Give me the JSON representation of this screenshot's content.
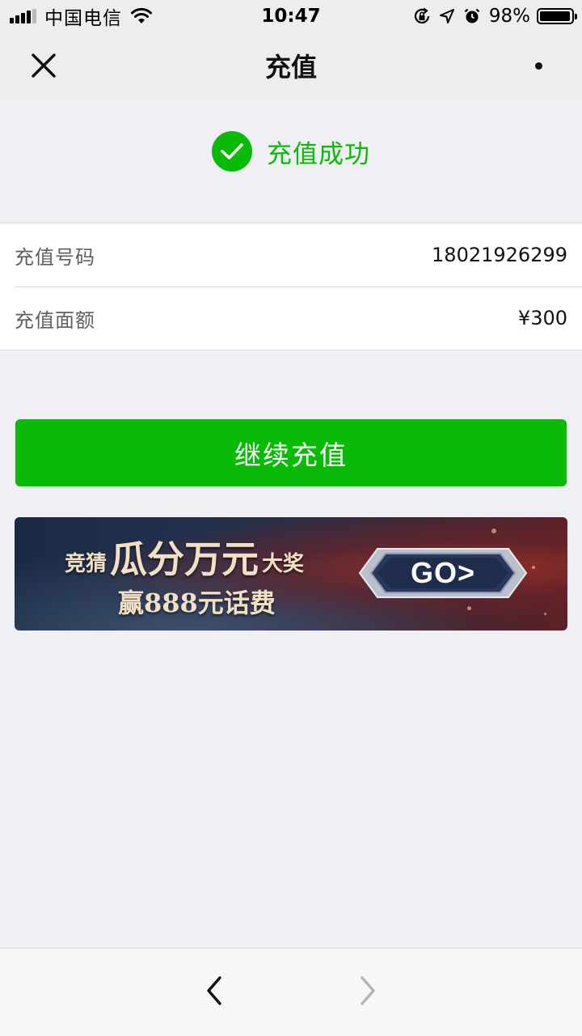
{
  "status_bar": {
    "carrier": "中国电信",
    "time": "10:47",
    "battery_percent": "98%",
    "battery_level": 0.98,
    "signal_bars": 4,
    "icons": [
      "wifi-icon",
      "orientation-lock-icon",
      "location-icon",
      "alarm-icon",
      "battery-icon"
    ]
  },
  "nav": {
    "title": "充值",
    "close_icon": "close-icon",
    "more_icon": "more-icon"
  },
  "success": {
    "text": "充值成功",
    "icon": "check-circle-icon",
    "color": "#09bb07"
  },
  "details": [
    {
      "label": "充值号码",
      "value": "18021926299"
    },
    {
      "label": "充值面额",
      "value": "¥300"
    }
  ],
  "continue_button": {
    "label": "继续充值",
    "color": "#09bb07"
  },
  "promo": {
    "line1_prefix": "竞猜",
    "line1_main": "瓜分万元",
    "line1_suffix": "大奖",
    "line2": "赢888元话费",
    "go_label": "GO>"
  },
  "toolbar": {
    "back_icon": "chevron-left-icon",
    "forward_icon": "chevron-right-icon"
  }
}
